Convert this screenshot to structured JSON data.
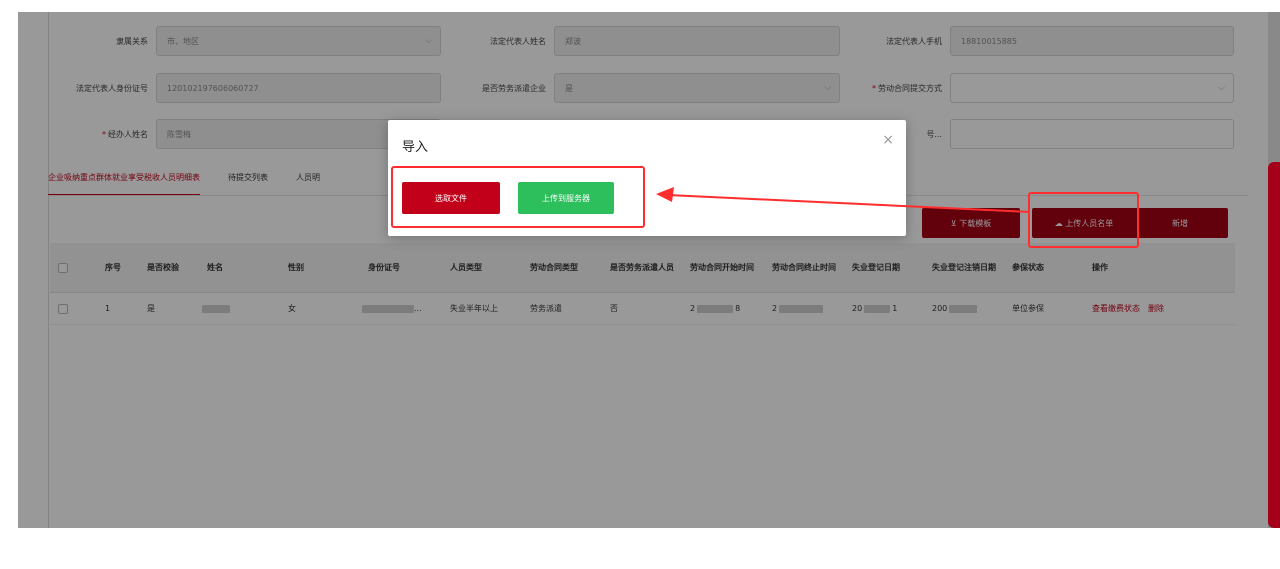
{
  "form": {
    "row1": [
      {
        "label": "隶属关系",
        "value": "市、地区",
        "dropdown": true
      },
      {
        "label": "法定代表人姓名",
        "value": "郑波"
      },
      {
        "label": "法定代表人手机",
        "value": "18810015885"
      }
    ],
    "row2": [
      {
        "label": "法定代表人身份证号",
        "value": "120102197606060727"
      },
      {
        "label": "是否劳务派遣企业",
        "value": "是",
        "dropdown": true
      },
      {
        "label": "劳动合同提交方式",
        "value": "",
        "required": true,
        "dropdown": true
      }
    ],
    "row3": [
      {
        "label": "经办人姓名",
        "value": "陈雪梅",
        "required": true
      },
      {
        "label": "号...",
        "value": ""
      }
    ]
  },
  "tabs": [
    "企业吸纳重点群体就业享受税收人员明细表",
    "待提交列表",
    "人员明"
  ],
  "toolbar": {
    "download": "⊻ 下载模板",
    "upload": "☁ 上传人员名单",
    "add": "新增"
  },
  "table": {
    "headers": [
      "序号",
      "是否校验",
      "姓名",
      "性别",
      "身份证号",
      "人员类型",
      "劳动合同类型",
      "是否劳务派遣人员",
      "劳动合同开始时间",
      "劳动合同终止时间",
      "失业登记日期",
      "失业登记注销日期",
      "参保状态",
      "操作"
    ],
    "rows": [
      {
        "index": "1",
        "checked": "是",
        "gender": "女",
        "id_suffix": "...",
        "person_type": "失业半年以上",
        "contract_type": "劳务派遣",
        "dispatch": "否",
        "start": "2",
        "start_tail": "8",
        "end": "2",
        "reg_date": "20",
        "reg_tail": "1",
        "reg_cancel": "200",
        "insurance": "单位参保",
        "action_view": "查看缴费状态",
        "action_delete": "删除"
      }
    ]
  },
  "modal": {
    "title": "导入",
    "close": "×",
    "choose_file": "选取文件",
    "upload_server": "上传到服务器"
  },
  "colors": {
    "primary": "#a30014",
    "active_tab": "#c0001a",
    "upload_green": "#2dbf5c",
    "annotation": "#ff2d2d"
  }
}
